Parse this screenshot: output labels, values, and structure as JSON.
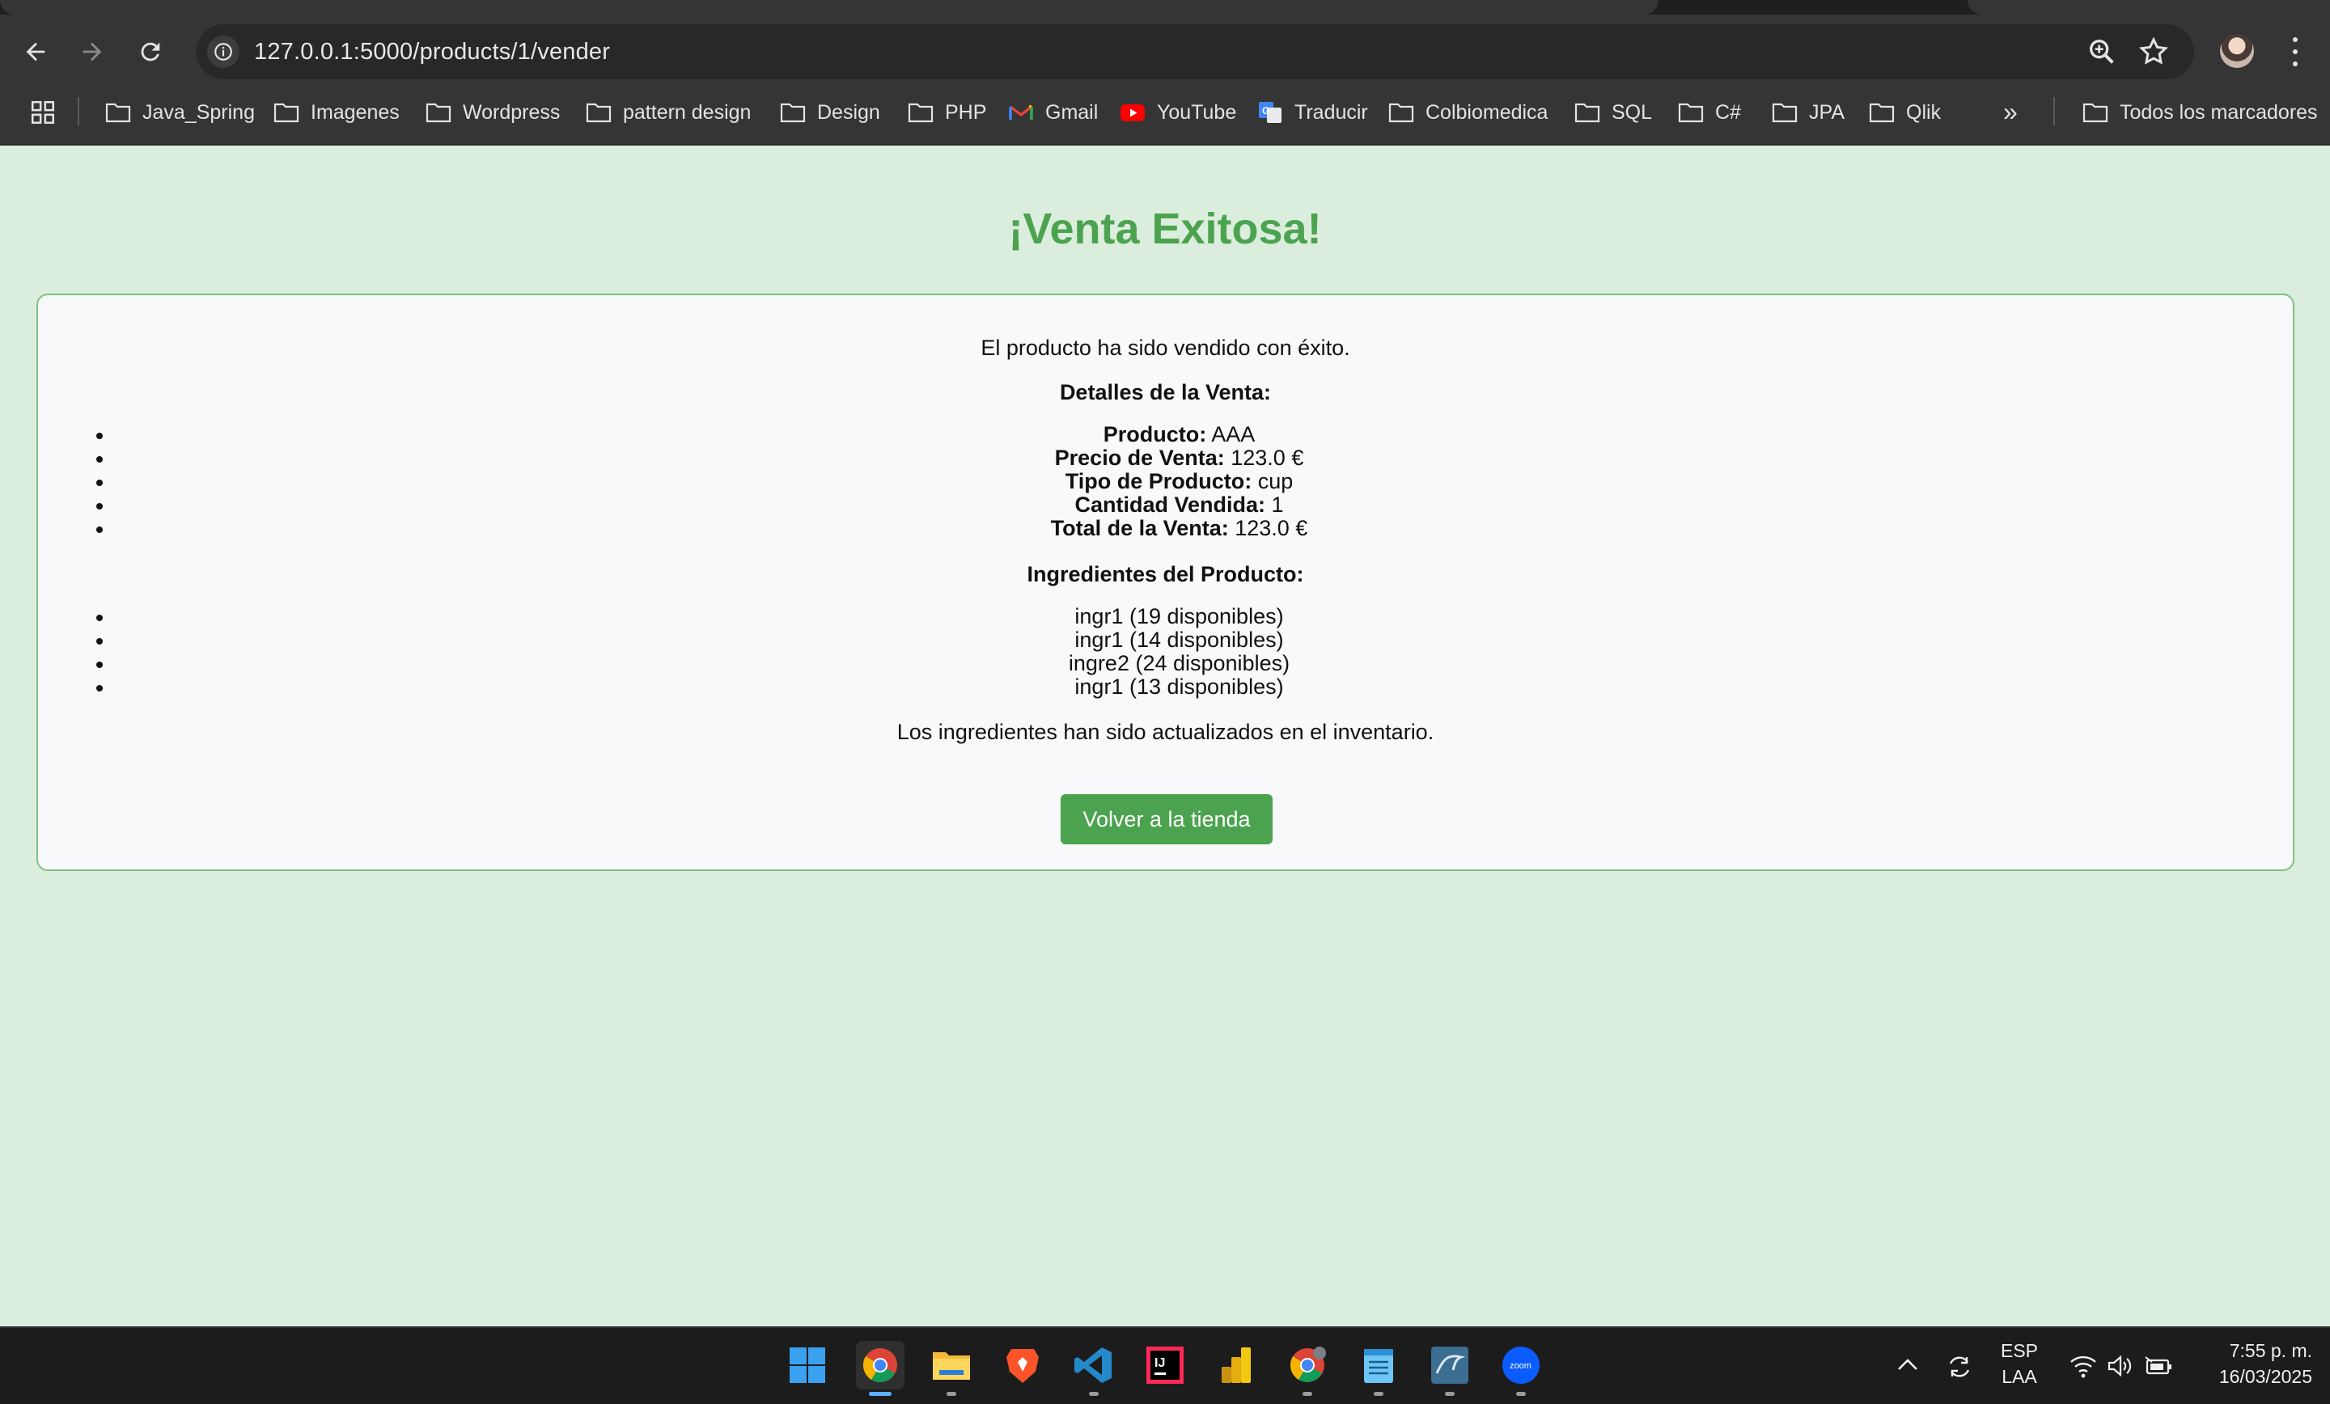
{
  "browser": {
    "url": "127.0.0.1:5000/products/1/vender",
    "bookmarks": [
      {
        "label": "Java_Spring",
        "icon": "folder-icon"
      },
      {
        "label": "Imagenes",
        "icon": "folder-icon"
      },
      {
        "label": "Wordpress",
        "icon": "folder-icon"
      },
      {
        "label": "pattern design",
        "icon": "folder-icon"
      },
      {
        "label": "Design",
        "icon": "folder-icon"
      },
      {
        "label": "PHP",
        "icon": "folder-icon"
      },
      {
        "label": "Gmail",
        "icon": "gmail-icon"
      },
      {
        "label": "YouTube",
        "icon": "youtube-icon"
      },
      {
        "label": "Traducir",
        "icon": "translate-icon"
      },
      {
        "label": "Colbiomedica",
        "icon": "folder-icon"
      },
      {
        "label": "SQL",
        "icon": "folder-icon"
      },
      {
        "label": "C#",
        "icon": "folder-icon"
      },
      {
        "label": "JPA",
        "icon": "folder-icon"
      },
      {
        "label": "Qlik",
        "icon": "folder-icon"
      }
    ],
    "more_bookmarks": "»",
    "all_bookmarks": "Todos los marcadores"
  },
  "page": {
    "title": "¡Venta Exitosa!",
    "message": "El producto ha sido vendido con éxito.",
    "details_heading": "Detalles de la Venta:",
    "details": [
      {
        "label": "Producto:",
        "value": "AAA"
      },
      {
        "label": "Precio de Venta:",
        "value": "123.0 €"
      },
      {
        "label": "Tipo de Producto:",
        "value": "cup"
      },
      {
        "label": "Cantidad Vendida:",
        "value": "1"
      },
      {
        "label": "Total de la Venta:",
        "value": "123.0 €"
      }
    ],
    "ingredients_heading": "Ingredientes del Producto:",
    "ingredients": [
      "ingr1 (19 disponibles)",
      "ingr1 (14 disponibles)",
      "ingre2 (24 disponibles)",
      "ingr1 (13 disponibles)"
    ],
    "inventory_note": "Los ingredientes han sido actualizados en el inventario.",
    "back_button": "Volver a la tienda",
    "colors": {
      "accent": "#4ca34f",
      "background": "#dbeddc",
      "card": "#f8f9fa"
    }
  },
  "taskbar": {
    "apps": [
      "windows-start-icon",
      "chrome-icon",
      "file-explorer-icon",
      "brave-icon",
      "vscode-icon",
      "intellij-icon",
      "powerbi-icon",
      "chrome-profile-icon",
      "notepad-icon",
      "mysql-workbench-icon",
      "zoom-icon"
    ],
    "language_top": "ESP",
    "language_bottom": "LAA",
    "time": "7:55 p. m.",
    "date": "16/03/2025"
  }
}
